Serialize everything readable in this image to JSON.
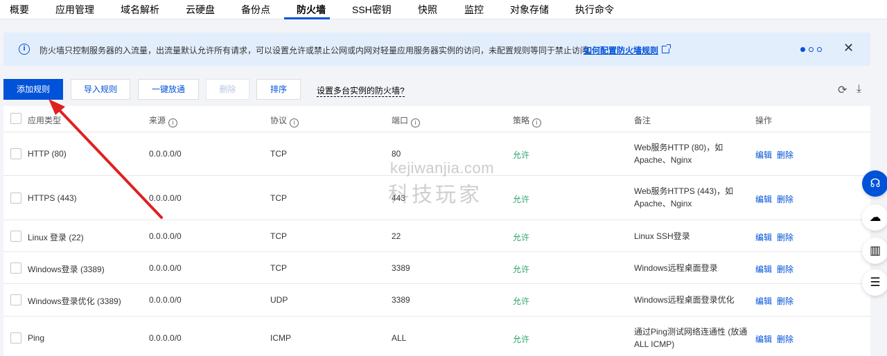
{
  "tabs": [
    {
      "label": "概要"
    },
    {
      "label": "应用管理"
    },
    {
      "label": "域名解析"
    },
    {
      "label": "云硬盘"
    },
    {
      "label": "备份点"
    },
    {
      "label": "防火墙"
    },
    {
      "label": "SSH密钥"
    },
    {
      "label": "快照"
    },
    {
      "label": "监控"
    },
    {
      "label": "对象存储"
    },
    {
      "label": "执行命令"
    }
  ],
  "active_tab": "防火墙",
  "banner": {
    "text": "防火墙只控制服务器的入流量，出流量默认允许所有请求，可以设置允许或禁止公网或内网对轻量应用服务器实例的访问，未配置规则等同于禁止访问。",
    "link": "如何配置防火墙规则",
    "close": "✕"
  },
  "toolbar": {
    "add": "添加规则",
    "import": "导入规则",
    "allow_all": "一键放通",
    "delete": "删除",
    "sort": "排序",
    "multi": "设置多台实例的防火墙?"
  },
  "table": {
    "headers": {
      "type": "应用类型",
      "source": "来源",
      "protocol": "协议",
      "port": "端口",
      "policy": "策略",
      "note": "备注",
      "action": "操作"
    },
    "rows": [
      {
        "type": "HTTP (80)",
        "source": "0.0.0.0/0",
        "protocol": "TCP",
        "port": "80",
        "policy": "允许",
        "note": "Web服务HTTP (80)，如Apache、Nginx",
        "edit": "编辑",
        "delete": "删除"
      },
      {
        "type": "HTTPS (443)",
        "source": "0.0.0.0/0",
        "protocol": "TCP",
        "port": "443",
        "policy": "允许",
        "note": "Web服务HTTPS (443)，如Apache、Nginx",
        "edit": "编辑",
        "delete": "删除"
      },
      {
        "type": "Linux 登录 (22)",
        "source": "0.0.0.0/0",
        "protocol": "TCP",
        "port": "22",
        "policy": "允许",
        "note": "Linux SSH登录",
        "edit": "编辑",
        "delete": "删除"
      },
      {
        "type": "Windows登录 (3389)",
        "source": "0.0.0.0/0",
        "protocol": "TCP",
        "port": "3389",
        "policy": "允许",
        "note": "Windows远程桌面登录",
        "edit": "编辑",
        "delete": "删除"
      },
      {
        "type": "Windows登录优化 (3389)",
        "source": "0.0.0.0/0",
        "protocol": "UDP",
        "port": "3389",
        "policy": "允许",
        "note": "Windows远程桌面登录优化",
        "edit": "编辑",
        "delete": "删除"
      },
      {
        "type": "Ping",
        "source": "0.0.0.0/0",
        "protocol": "ICMP",
        "port": "ALL",
        "policy": "允许",
        "note": "通过Ping测试网络连通性 (放通ALL ICMP)",
        "edit": "编辑",
        "delete": "删除"
      }
    ]
  },
  "watermark": {
    "line1": "kejiwanjia.com",
    "line2": "科技玩家"
  },
  "colors": {
    "accent": "#0052d9",
    "allow": "#2ba471",
    "banner_bg": "#e3eefc",
    "arrow": "#e02020"
  },
  "icons": {
    "banner": "info-icon",
    "link": "external-link-icon",
    "refresh": "refresh-icon",
    "download": "download-icon",
    "floating": [
      "support-icon",
      "cloud-icon",
      "book-icon",
      "list-icon"
    ]
  }
}
